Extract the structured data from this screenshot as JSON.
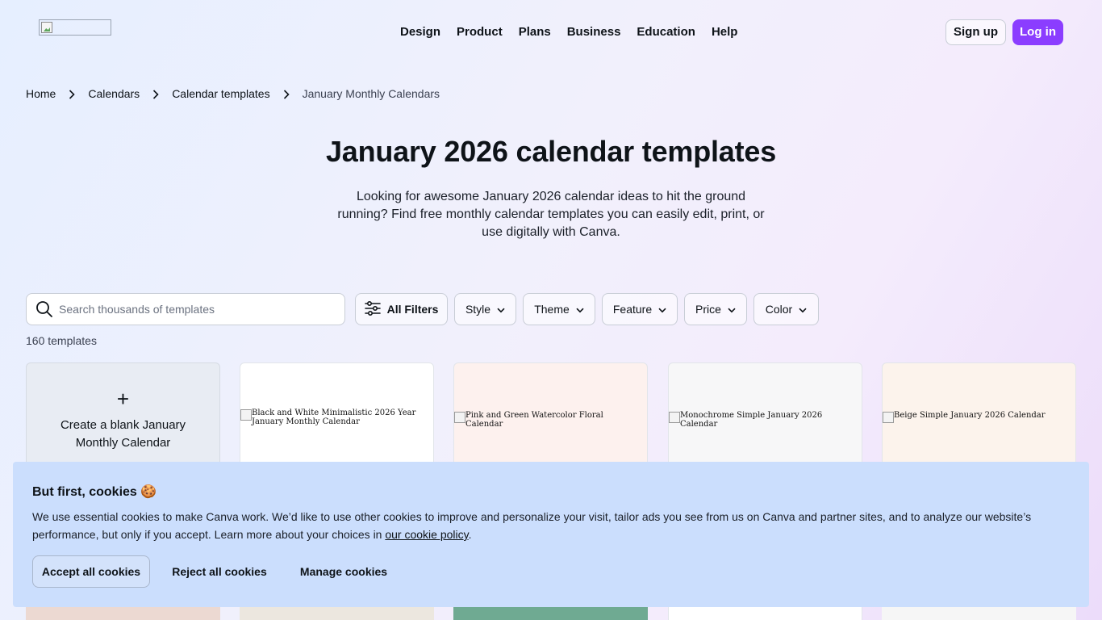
{
  "header": {
    "logo_alt": "",
    "nav": [
      "Design",
      "Product",
      "Plans",
      "Business",
      "Education",
      "Help"
    ],
    "signup_label": "Sign up",
    "login_label": "Log in",
    "accent_color": "#8b3dff"
  },
  "breadcrumb": {
    "items": [
      "Home",
      "Calendars",
      "Calendar templates",
      "January Monthly Calendars"
    ]
  },
  "hero": {
    "title": "January 2026 calendar templates",
    "description": "Looking for awesome January 2026 calendar ideas to hit the ground running? Find free monthly calendar templates you can easily edit, print, or use digitally with Canva."
  },
  "filters": {
    "search_placeholder": "Search thousands of templates",
    "all_filters_label": "All Filters",
    "dropdowns": [
      "Style",
      "Theme",
      "Feature",
      "Price",
      "Color"
    ]
  },
  "results": {
    "count_label": "160 templates",
    "blank_card_label": "Create a blank January Monthly Calendar",
    "templates": [
      "Black and White Minimalistic 2026 Year January Monthly Calendar",
      "Pink and Green Watercolor Floral Calendar",
      "Monochrome Simple January 2026 Calendar",
      "Beige Simple January 2026 Calendar"
    ]
  },
  "cookie_banner": {
    "title": "But first, cookies 🍪",
    "body": "We use essential cookies to make Canva work. We’d like to use other cookies to improve and personalize your visit, tailor ads you see from us on Canva and partner sites, and to analyze our website’s performance, but only if you accept. Learn more about your choices in ",
    "policy_link": "our cookie policy",
    "body_end": ".",
    "accept_label": "Accept all cookies",
    "reject_label": "Reject all cookies",
    "manage_label": "Manage cookies",
    "background_color": "#cbdefd"
  }
}
